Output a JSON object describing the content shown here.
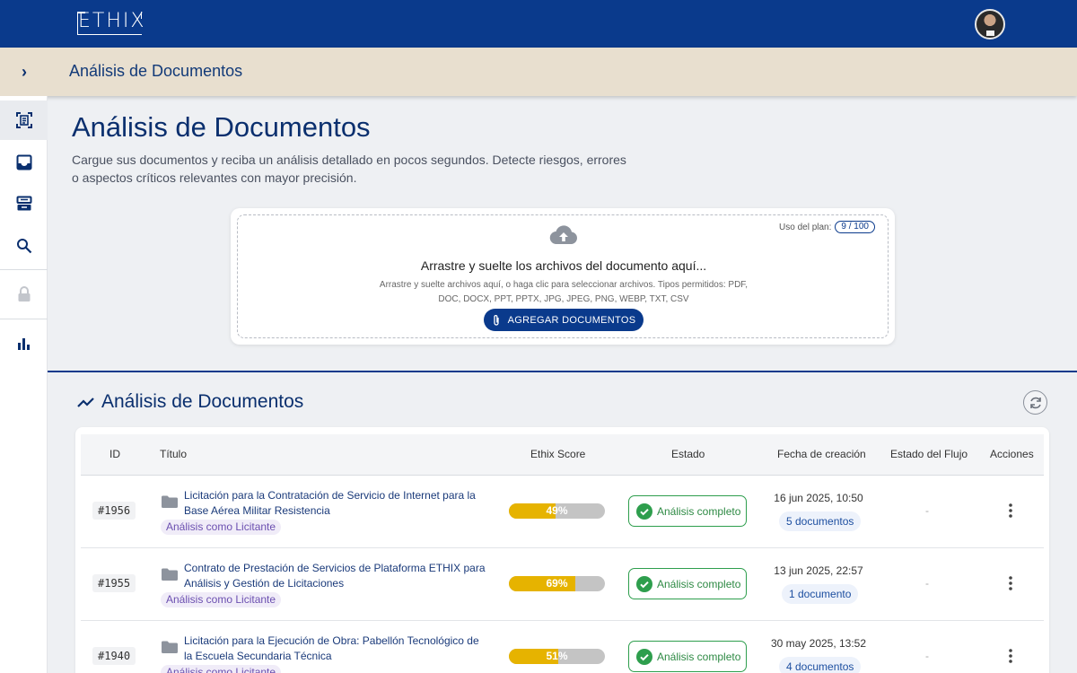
{
  "header": {
    "logo_text": "ETHIX",
    "breadcrumb_title": "Análisis de Documentos"
  },
  "sidebar": {
    "items": [
      {
        "icon": "document-scan-icon",
        "active": true
      },
      {
        "icon": "inbox-icon"
      },
      {
        "icon": "inbox-stack-icon"
      },
      {
        "icon": "search-icon"
      },
      {
        "icon": "lock-icon"
      },
      {
        "icon": "bar-chart-icon"
      }
    ]
  },
  "main": {
    "title": "Análisis de Documentos",
    "description": "Cargue sus documentos y reciba un análisis detallado en pocos segundos. Detecte riesgos, errores o aspectos críticos relevantes con mayor precisión."
  },
  "upload": {
    "plan_label": "Uso del plan:",
    "plan_usage": "9 / 100",
    "drop_title": "Arrastre y suelte los archivos del documento aquí...",
    "drop_subtitle": "Arrastre y suelte archivos aquí, o haga clic para seleccionar archivos. Tipos permitidos: PDF, DOC, DOCX, PPT, PPTX, JPG, JPEG, PNG, WEBP, TXT, CSV",
    "add_button": "AGREGAR DOCUMENTOS"
  },
  "section": {
    "title": "Análisis de Documentos"
  },
  "table": {
    "headers": {
      "id": "ID",
      "title": "Título",
      "score": "Ethix Score",
      "status": "Estado",
      "created": "Fecha de creación",
      "flow": "Estado del Flujo",
      "actions": "Acciones"
    },
    "rows": [
      {
        "id": "#1956",
        "title": "Licitación para la Contratación de Servicio de Internet para la Base Aérea Militar Resistencia",
        "tag": "Análisis como Licitante",
        "score": "49%",
        "score_value": 0.49,
        "status": "Análisis completo",
        "date": "16 jun 2025, 10:50",
        "docs": "5 documentos",
        "flow": "-"
      },
      {
        "id": "#1955",
        "title": "Contrato de Prestación de Servicios de Plataforma ETHIX para Análisis y Gestión de Licitaciones",
        "tag": "Análisis como Licitante",
        "score": "69%",
        "score_value": 0.69,
        "status": "Análisis completo",
        "date": "13 jun 2025, 22:57",
        "docs": "1 documento",
        "flow": "-"
      },
      {
        "id": "#1940",
        "title": "Licitación para la Ejecución de Obra: Pabellón Tecnológico de la Escuela Secundaria Técnica",
        "tag": "Análisis como Licitante",
        "score": "51%",
        "score_value": 0.51,
        "status": "Análisis completo",
        "date": "30 may 2025, 13:52",
        "docs": "4 documentos",
        "flow": "-"
      }
    ]
  },
  "colors": {
    "primary": "#0a3a8c",
    "breadcrumb_bg": "#e8dfcf",
    "score_fill": "#e6b300",
    "status_green": "#2e9e4d"
  }
}
